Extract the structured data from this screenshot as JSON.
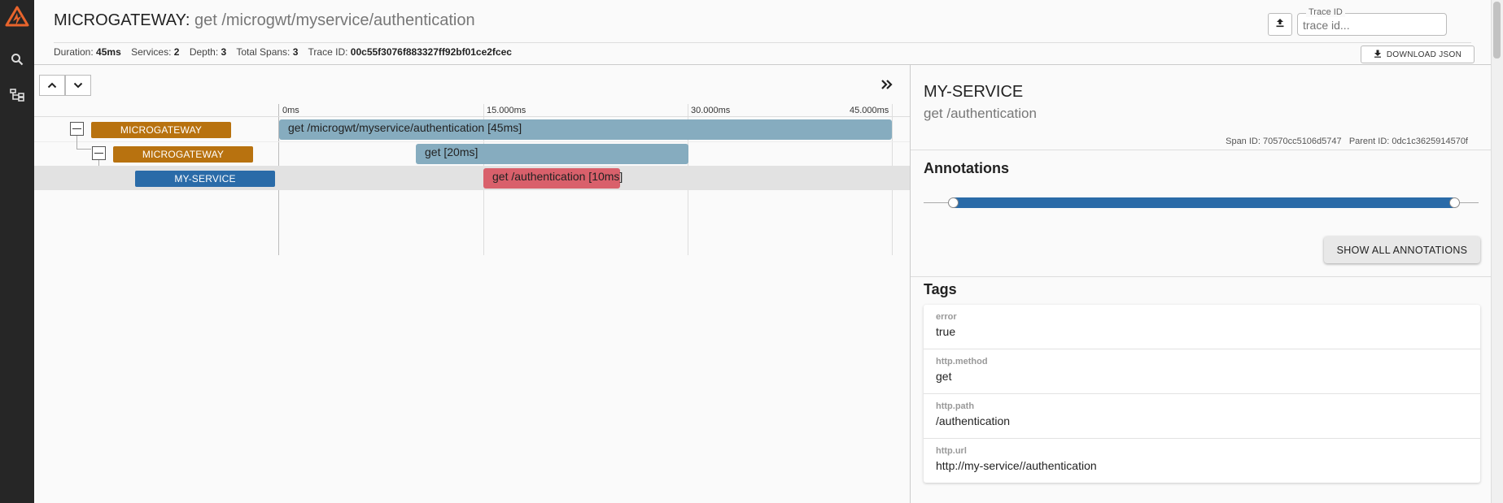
{
  "header": {
    "service": "MICROGATEWAY",
    "separator": ":",
    "operation": "get /microgwt/myservice/authentication",
    "meta": {
      "duration_label": "Duration:",
      "duration": "45ms",
      "services_label": "Services:",
      "services": "2",
      "depth_label": "Depth:",
      "depth": "3",
      "total_spans_label": "Total Spans:",
      "total_spans": "3",
      "trace_id_label": "Trace ID:",
      "trace_id": "00c55f3076f883327ff92bf01ce2fcec"
    },
    "trace_input": {
      "label": "Trace ID",
      "placeholder": "trace id..."
    },
    "download_label": "DOWNLOAD JSON"
  },
  "nav": {
    "icons": [
      "logo-icon",
      "search-icon",
      "dependencies-icon"
    ]
  },
  "timeline": {
    "ticks": [
      "0ms",
      "15.000ms",
      "30.000ms",
      "45.000ms"
    ],
    "spans": [
      {
        "service": "MICROGATEWAY",
        "text": "get /microgwt/myservice/authentication [45ms]"
      },
      {
        "service": "MICROGATEWAY",
        "text": "get [20ms]"
      },
      {
        "service": "MY-SERVICE",
        "text": "get /authentication [10ms]"
      }
    ]
  },
  "detail": {
    "service": "MY-SERVICE",
    "operation": "get /authentication",
    "span_id_label": "Span ID:",
    "span_id": "70570cc5106d5747",
    "parent_id_label": "Parent ID:",
    "parent_id": "0dc1c3625914570f",
    "annotations_title": "Annotations",
    "show_all_label": "SHOW ALL ANNOTATIONS",
    "tags_title": "Tags",
    "tags": [
      {
        "key": "error",
        "value": "true"
      },
      {
        "key": "http.method",
        "value": "get"
      },
      {
        "key": "http.path",
        "value": "/authentication"
      },
      {
        "key": "http.url",
        "value": "http://my-service//authentication"
      }
    ]
  },
  "colors": {
    "microgateway": "#b8720f",
    "my_service": "#2a6ba8",
    "span_normal": "#86acbf",
    "span_error": "#d9606b",
    "sidebar": "#262626",
    "logo": "#e8642c"
  }
}
